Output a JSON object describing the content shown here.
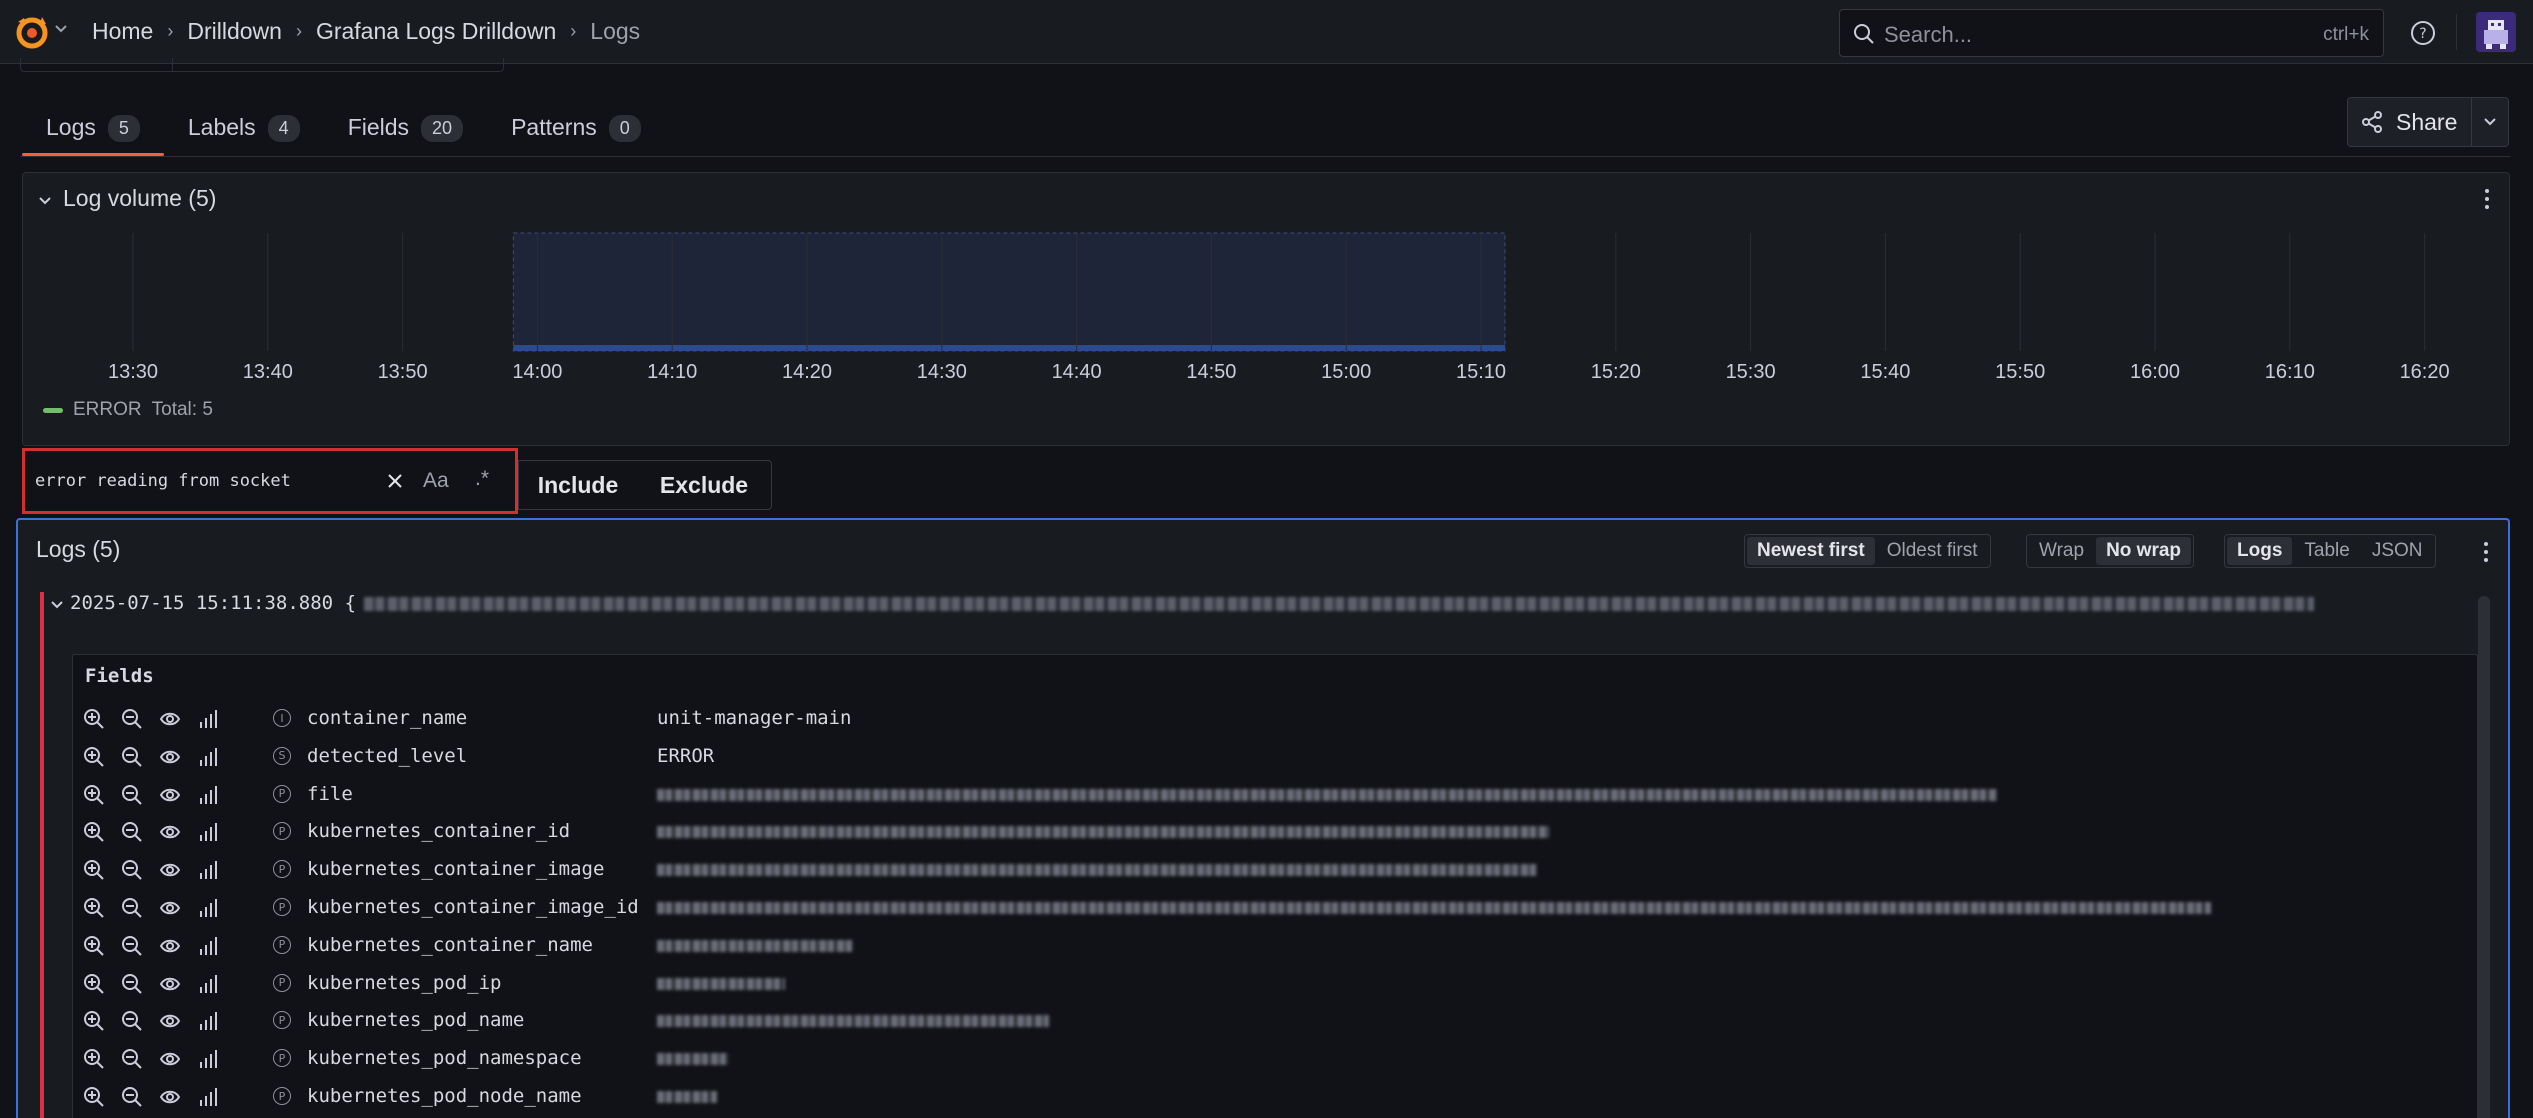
{
  "nav": {
    "breadcrumbs": [
      "Home",
      "Drilldown",
      "Grafana Logs Drilldown",
      "Logs"
    ],
    "search_placeholder": "Search...",
    "search_shortcut": "ctrl+k"
  },
  "tabs": [
    {
      "label": "Logs",
      "count": "5",
      "active": true
    },
    {
      "label": "Labels",
      "count": "4"
    },
    {
      "label": "Fields",
      "count": "20"
    },
    {
      "label": "Patterns",
      "count": "0"
    }
  ],
  "share_label": "Share",
  "volume": {
    "title": "Log volume (5)",
    "legend_label": "ERROR",
    "legend_total": "Total: 5"
  },
  "chart_data": {
    "type": "bar",
    "x_ticks": [
      "13:30",
      "13:40",
      "13:50",
      "14:00",
      "14:10",
      "14:20",
      "14:30",
      "14:40",
      "14:50",
      "15:00",
      "15:10",
      "15:20",
      "15:30",
      "15:40",
      "15:50",
      "16:00",
      "16:10",
      "16:20"
    ],
    "highlight_range": [
      "14:00",
      "15:10"
    ],
    "series": [
      {
        "name": "ERROR",
        "color": "#73bf69"
      }
    ],
    "legend": "bottom-left"
  },
  "filter": {
    "value": "error reading from socket",
    "case_label": "Aa",
    "regex_label": ".*",
    "include_label": "Include",
    "exclude_label": "Exclude"
  },
  "logs": {
    "title": "Logs (5)",
    "sort_options": [
      "Newest first",
      "Oldest first"
    ],
    "wrap_options": [
      "Wrap",
      "No wrap"
    ],
    "view_options": [
      "Logs",
      "Table",
      "JSON"
    ],
    "line_timestamp": "2025-07-15 15:11:38.880",
    "line_prefix": "{",
    "fields_title": "Fields",
    "fields": [
      {
        "type": "I",
        "name": "container_name",
        "value": "unit-manager-main"
      },
      {
        "type": "S",
        "name": "detected_level",
        "value": "ERROR"
      },
      {
        "type": "P",
        "name": "file",
        "value": ""
      },
      {
        "type": "P",
        "name": "kubernetes_container_id",
        "value": ""
      },
      {
        "type": "P",
        "name": "kubernetes_container_image",
        "value": ""
      },
      {
        "type": "P",
        "name": "kubernetes_container_image_id",
        "value": ""
      },
      {
        "type": "P",
        "name": "kubernetes_container_name",
        "value": ""
      },
      {
        "type": "P",
        "name": "kubernetes_pod_ip",
        "value": ""
      },
      {
        "type": "P",
        "name": "kubernetes_pod_name",
        "value": ""
      },
      {
        "type": "P",
        "name": "kubernetes_pod_namespace",
        "value": ""
      },
      {
        "type": "P",
        "name": "kubernetes_pod_node_name",
        "value": ""
      }
    ]
  },
  "colors": {
    "accent_tab": "#f55f3e",
    "error_bar": "#e02f44",
    "panel_focus": "#3d71d9",
    "filter_highlight": "#d32f2f"
  }
}
